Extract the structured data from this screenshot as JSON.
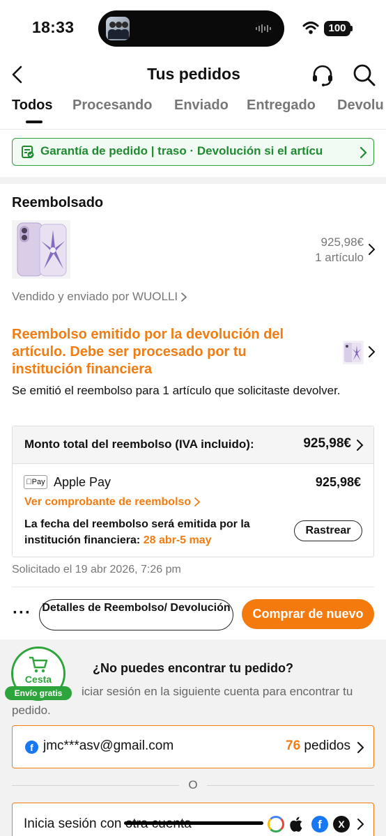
{
  "status_bar": {
    "time": "18:33",
    "battery": "100"
  },
  "header": {
    "title": "Tus pedidos",
    "tabs": [
      "Todos",
      "Procesando",
      "Enviado",
      "Entregado",
      "Devolu"
    ]
  },
  "guarantee_banner": {
    "text": "Garantía de pedido | traso · Devolución si el artícu"
  },
  "order": {
    "status": "Reembolsado",
    "price": "925,98€",
    "item_count": "1 artículo",
    "seller": "Vendido y enviado por WUOLLI",
    "refund_headline": "Reembolso emitido por la devolución del artículo. Debe ser procesado por tu institución financiera",
    "refund_sub": "Se emitió el reembolso para 1 artículo que solicitaste devolver.",
    "refund_total_label": "Monto total del reembolso (IVA incluido):",
    "refund_total_value": "925,98€",
    "payment_logo": "Pay",
    "payment_method": "Apple Pay",
    "payment_amount": "925,98€",
    "receipt_link": "Ver comprobante de reembolso",
    "refund_date_note": "La fecha del reembolso será emitida por la institución financiera:",
    "refund_date_range": "28 abr-5 may",
    "track_button": "Rastrear",
    "requested_at": "Solicitado el 19 abr 2026, 7:26 pm",
    "more": "···",
    "details_button": "Detalles de Reembolso/ Devolución",
    "buy_again_button": "Comprar de nuevo"
  },
  "find_order": {
    "title": "¿No puedes encontrar tu pedido?",
    "subtitle": "iciar sesión en la siguiente cuenta para encontrar tu pedido.",
    "account_email": "jmc***asv@gmail.com",
    "orders_count": "76",
    "orders_label": " pedidos",
    "or": "O",
    "other_login": "Inicia sesión con otra cuenta"
  },
  "cart": {
    "label": "Cesta",
    "badge": "Envío gratis"
  },
  "colors": {
    "accent": "#f57a0d",
    "green": "#2e9e3c"
  },
  "icons": [
    "back-icon",
    "support-icon",
    "search-icon",
    "shield-icon",
    "chevron-right-icon",
    "cart-icon",
    "google-icon",
    "apple-icon",
    "facebook-icon",
    "x-icon",
    "wifi-icon"
  ]
}
